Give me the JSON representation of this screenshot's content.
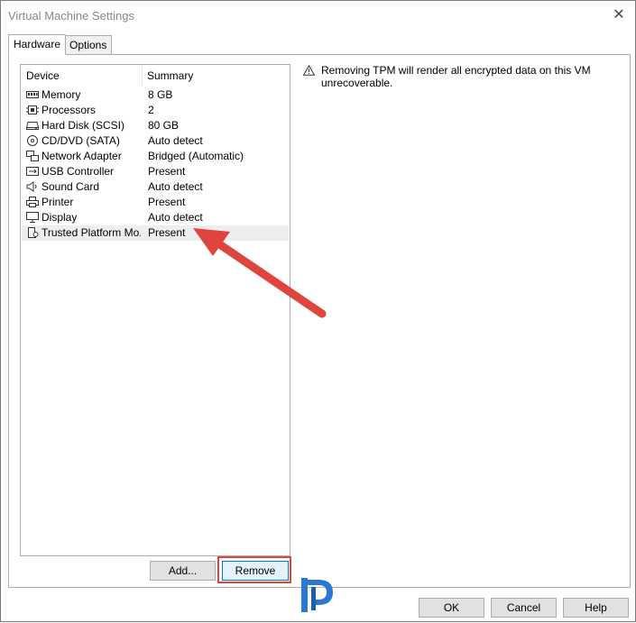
{
  "window": {
    "title": "Virtual Machine Settings",
    "close_glyph": "✕"
  },
  "tabs": [
    {
      "label": "Hardware",
      "active": true
    },
    {
      "label": "Options",
      "active": false
    }
  ],
  "device_list": {
    "columns": {
      "device": "Device",
      "summary": "Summary"
    },
    "items": [
      {
        "icon": "memory-icon",
        "device": "Memory",
        "summary": "8 GB"
      },
      {
        "icon": "processor-icon",
        "device": "Processors",
        "summary": "2"
      },
      {
        "icon": "hard-disk-icon",
        "device": "Hard Disk (SCSI)",
        "summary": "80 GB"
      },
      {
        "icon": "cd-dvd-icon",
        "device": "CD/DVD (SATA)",
        "summary": "Auto detect"
      },
      {
        "icon": "network-adapter-icon",
        "device": "Network Adapter",
        "summary": "Bridged (Automatic)"
      },
      {
        "icon": "usb-icon",
        "device": "USB Controller",
        "summary": "Present"
      },
      {
        "icon": "sound-card-icon",
        "device": "Sound Card",
        "summary": "Auto detect"
      },
      {
        "icon": "printer-icon",
        "device": "Printer",
        "summary": "Present"
      },
      {
        "icon": "display-icon",
        "device": "Display",
        "summary": "Auto detect"
      },
      {
        "icon": "tpm-icon",
        "device": "Trusted Platform Mo...",
        "summary": "Present",
        "selected": true
      }
    ]
  },
  "warning": {
    "icon": "warning-icon",
    "text": "Removing TPM will render all encrypted data on this VM unrecoverable."
  },
  "buttons": {
    "add": "Add...",
    "remove": "Remove",
    "ok": "OK",
    "cancel": "Cancel",
    "help": "Help"
  },
  "annotation": {
    "highlight_color": "#e0443f",
    "arrow_color": "#e0443f"
  },
  "logo": {
    "icon": "prajwal-logo-icon",
    "color": "#2b78d0"
  }
}
